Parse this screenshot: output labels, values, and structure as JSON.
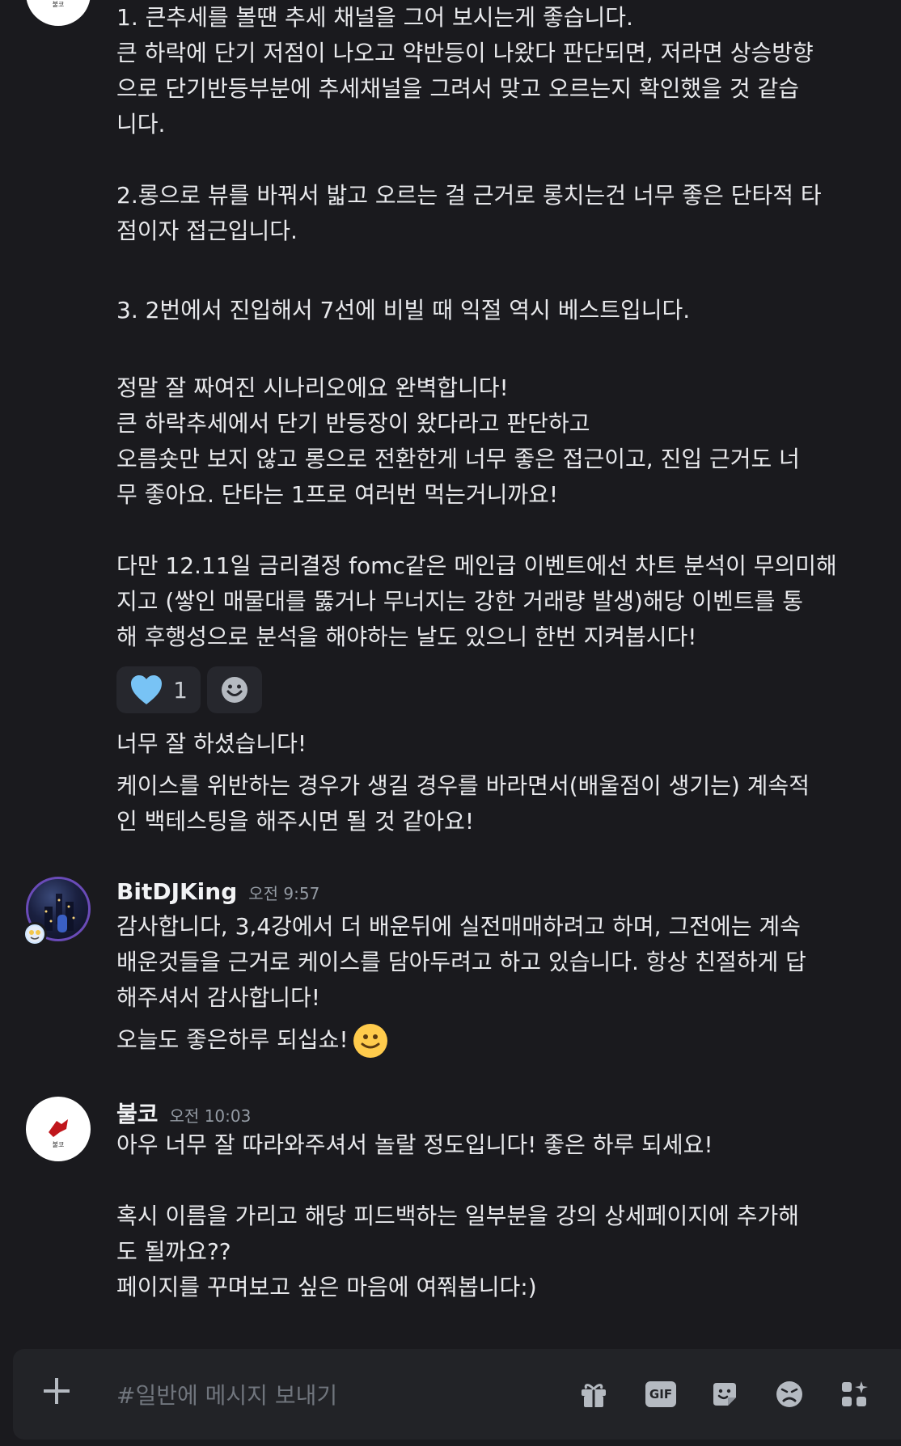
{
  "colors": {
    "background": "#1a1a1e",
    "text": "#e8e9ec",
    "muted": "#949ba4",
    "composer": "#222327"
  },
  "message1": {
    "avatar_logo_text": "불코",
    "lines": [
      "1. 큰추세를 볼땐 추세 채널을 그어 보시는게 좋습니다.",
      "큰 하락에 단기 저점이 나오고 약반등이 나왔다 판단되면, 저라면 상승방향",
      "으로 단기반등부분에 추세채널을 그려서 맞고 오르는지 확인했을 것 같습",
      "니다.",
      "",
      "2.롱으로 뷰를 바꿔서 밟고 오르는 걸 근거로 롱치는건 너무 좋은 단타적 타",
      "점이자 접근입니다.",
      "",
      "3. 2번에서 진입해서 7선에 비빌 때 익절 역시 베스트입니다.",
      "",
      "정말 잘 짜여진 시나리오에요 완벽합니다!",
      "큰 하락추세에서 단기 반등장이 왔다라고 판단하고",
      "오름숏만 보지 않고 롱으로 전환한게 너무 좋은 접근이고, 진입 근거도 너",
      "무 좋아요. 단타는 1프로 여러번 먹는거니까요!",
      "",
      "다만 12.11일 금리결정 fomc같은 메인급 이벤트에선 차트 분석이 무의미해",
      "지고 (쌓인 매물대를 뚫거나 무너지는 강한 거래량 발생)해당 이벤트를 통",
      "해 후행성으로 분석을 해야하는 날도 있으니 한번 지켜봅시다!"
    ],
    "reaction": {
      "icon": "heart-icon",
      "count": "1"
    },
    "followup": [
      "너무 잘 하셨습니다!",
      "케이스를 위반하는 경우가 생길 경우를 바라면서(배울점이 생기는) 계속적",
      "인 백테스팅을 해주시면 될 것 같아요!"
    ]
  },
  "message2": {
    "username": "BitDJKing",
    "time": "오전 9:57",
    "lines": [
      "감사합니다, 3,4강에서 더 배운뒤에 실전매매하려고 하며, 그전에는 계속",
      "배운것들을 근거로 케이스를 담아두려고 하고 있습니다. 항상 친절하게 답",
      "해주셔서 감사합니다!"
    ],
    "last_line": "오늘도 좋은하루 되십쇼!"
  },
  "message3": {
    "username": "불코",
    "time": "오전 10:03",
    "avatar_logo_text": "불코",
    "lines": [
      "아우 너무 잘 따라와주셔서 놀랄 정도입니다! 좋은 하루 되세요!",
      "",
      "혹시 이름을 가리고 해당 피드백하는 일부분을 강의 상세페이지에 추가해",
      "도 될까요??",
      "페이지를 꾸며보고 싶은 마음에 여쭤봅니다:)"
    ]
  },
  "composer": {
    "placeholder": "#일반에 메시지 보내기",
    "gif_label": "GIF",
    "icons": [
      "plus-icon",
      "gift-icon",
      "gif-icon",
      "sticker-icon",
      "emoji-icon",
      "apps-icon"
    ]
  }
}
